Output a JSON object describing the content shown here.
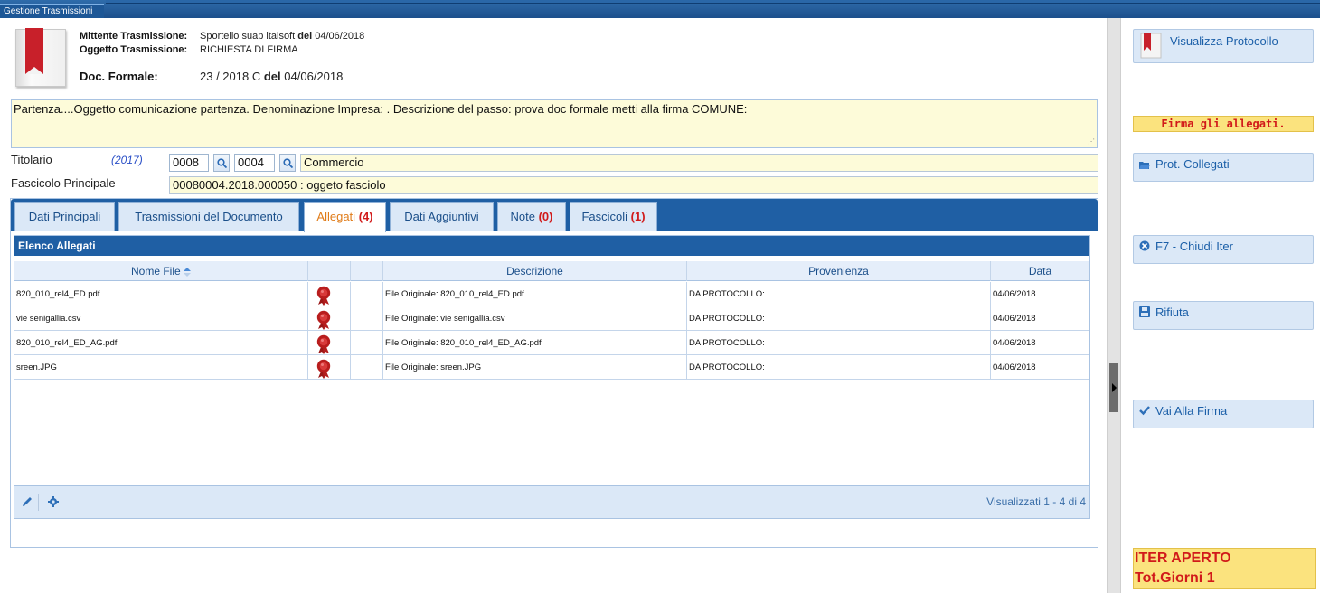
{
  "window": {
    "tab_title": "Gestione Trasmissioni"
  },
  "header": {
    "mittente_label": "Mittente Trasmissione:",
    "mittente_value": "Sportello suap italsoft",
    "mittente_del": "del",
    "mittente_date": "04/06/2018",
    "oggetto_label": "Oggetto Trasmissione:",
    "oggetto_value": "RICHIESTA DI FIRMA",
    "doc_label": "Doc. Formale:",
    "doc_value": "23 / 2018 C",
    "doc_del": "del",
    "doc_date": "04/06/2018"
  },
  "description": "Partenza....Oggetto comunicazione partenza. Denominazione Impresa: . Descrizione del passo: prova doc formale metti alla firma COMUNE:",
  "titolario": {
    "label": "Titolario",
    "year": "(2017)",
    "code1": "0008",
    "code2": "0004",
    "desc": "Commercio"
  },
  "fascicolo": {
    "label": "Fascicolo Principale",
    "value": "00080004.2018.000050 : oggeto fasciolo"
  },
  "tabs": [
    {
      "label": "Dati Principali",
      "count": ""
    },
    {
      "label": "Trasmissioni del Documento",
      "count": ""
    },
    {
      "label": "Allegati",
      "count": "(4)"
    },
    {
      "label": "Dati Aggiuntivi",
      "count": ""
    },
    {
      "label": "Note",
      "count": "(0)"
    },
    {
      "label": "Fascicoli",
      "count": "(1)"
    }
  ],
  "grid": {
    "caption": "Elenco Allegati",
    "columns": [
      "Nome File",
      "",
      "",
      "Descrizione",
      "Provenienza",
      "Data"
    ],
    "rows": [
      {
        "name": "820_010_rel4_ED.pdf",
        "desc": "File Originale: 820_010_rel4_ED.pdf",
        "prov": "DA PROTOCOLLO:",
        "date": "04/06/2018"
      },
      {
        "name": "vie senigallia.csv",
        "desc": "File Originale: vie senigallia.csv",
        "prov": "DA PROTOCOLLO:",
        "date": "04/06/2018"
      },
      {
        "name": "820_010_rel4_ED_AG.pdf",
        "desc": "File Originale: 820_010_rel4_ED_AG.pdf",
        "prov": "DA PROTOCOLLO:",
        "date": "04/06/2018"
      },
      {
        "name": "sreen.JPG",
        "desc": "File Originale: sreen.JPG",
        "prov": "DA PROTOCOLLO:",
        "date": "04/06/2018"
      }
    ],
    "footer_text": "Visualizzati 1 - 4 di 4"
  },
  "right_panel": {
    "visualizza": "Visualizza Protocollo",
    "firma_note": "Firma gli allegati.",
    "prot_collegati": "Prot. Collegati",
    "chiudi_iter": "F7 - Chiudi Iter",
    "rifiuta": "Rifiuta",
    "vai_firma": "Vai Alla Firma",
    "iter_status": "ITER APERTO",
    "iter_days": "Tot.Giorni 1"
  },
  "colors": {
    "accent": "#1f5fa4",
    "highlight": "#fbe37e",
    "alert": "#d11a1a",
    "active_tab": "#e07b18"
  }
}
